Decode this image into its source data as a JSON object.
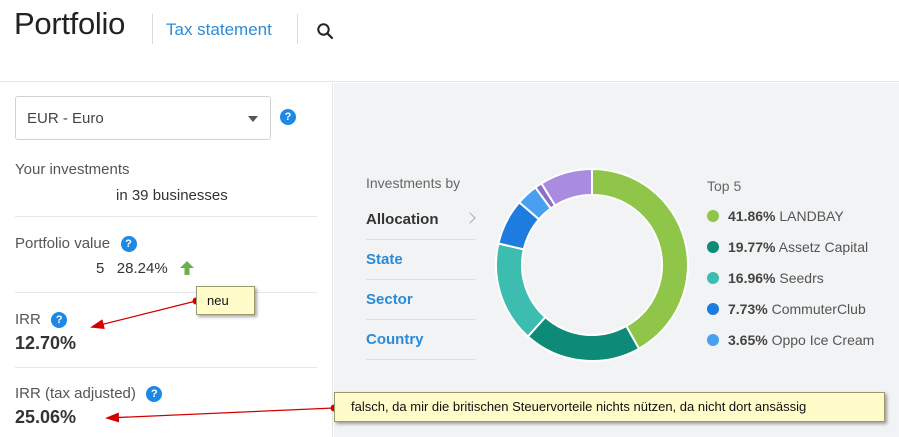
{
  "header": {
    "title": "Portfolio",
    "tax_link": "Tax statement",
    "search_icon": "search-icon"
  },
  "left": {
    "currency": {
      "selected": "EUR - Euro"
    },
    "help_icon_glyph": "?",
    "investments": {
      "label": "Your investments",
      "businesses": "in 39 businesses"
    },
    "portfolio_value": {
      "label": "Portfolio value",
      "amount_fragment": "5",
      "change": "28.24%"
    },
    "irr": {
      "label": "IRR",
      "value": "12.70%"
    },
    "irr_tax": {
      "label": "IRR (tax adjusted)",
      "value": "25.06%"
    }
  },
  "right": {
    "investments_by": "Investments by",
    "nav": [
      {
        "label": "Allocation",
        "active": true
      },
      {
        "label": "State",
        "active": false
      },
      {
        "label": "Sector",
        "active": false
      },
      {
        "label": "Country",
        "active": false
      }
    ],
    "top5_label": "Top 5",
    "legend": [
      {
        "pct": "41.86%",
        "name": "LANDBAY",
        "color": "#8fc64a"
      },
      {
        "pct": "19.77%",
        "name": "Assetz Capital",
        "color": "#0e8a78"
      },
      {
        "pct": "16.96%",
        "name": "Seedrs",
        "color": "#3dbcb0"
      },
      {
        "pct": "7.73%",
        "name": "CommuterClub",
        "color": "#1e7be0"
      },
      {
        "pct": "3.65%",
        "name": "Oppo Ice Cream",
        "color": "#4aa0f0"
      }
    ]
  },
  "chart_data": {
    "type": "pie",
    "categories": [
      "LANDBAY",
      "Assetz Capital",
      "Seedrs",
      "CommuterClub",
      "Oppo Ice Cream",
      "Other (purple small)",
      "Other (lavender)"
    ],
    "values": [
      41.86,
      19.77,
      16.96,
      7.73,
      3.65,
      1.2,
      8.83
    ],
    "colors": [
      "#8fc64a",
      "#0e8a78",
      "#3dbcb0",
      "#1e7be0",
      "#4aa0f0",
      "#8a6fc9",
      "#a98be0"
    ]
  },
  "annotations": {
    "neu": "neu",
    "falsch": "falsch, da mir die britischen Steuervorteile nichts nützen, da nicht dort ansässig"
  }
}
